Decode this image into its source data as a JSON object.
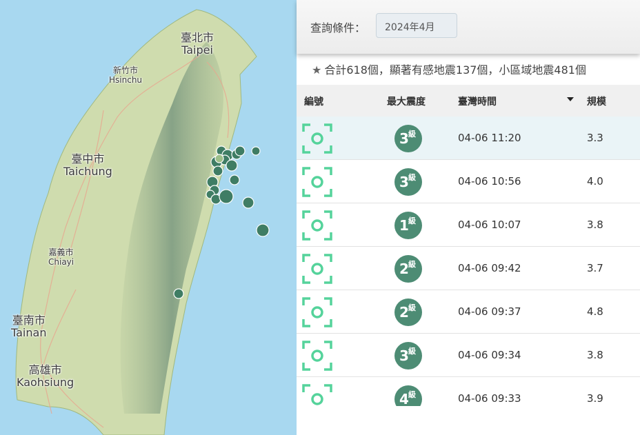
{
  "map": {
    "colors": {
      "sea": "#a8d8f0",
      "land": "#cfdcae",
      "mountain": "#8aa78a",
      "marker": "#3f7d64"
    },
    "cities": [
      {
        "zh": "臺北市",
        "en": "Taipei",
        "size": "big"
      },
      {
        "zh": "新竹市",
        "en": "Hsinchu",
        "size": "small"
      },
      {
        "zh": "臺中市",
        "en": "Taichung",
        "size": "big"
      },
      {
        "zh": "嘉義市",
        "en": "Chiayi",
        "size": "small"
      },
      {
        "zh": "臺南市",
        "en": "Tainan",
        "size": "big"
      },
      {
        "zh": "高雄市",
        "en": "Kaohsiung",
        "size": "big"
      }
    ]
  },
  "query": {
    "label": "查詢條件：",
    "selected": "2024年4月"
  },
  "summary": {
    "text": "合計618個，顯著有感地震137個，小區域地震481個"
  },
  "table": {
    "headers": {
      "id": "編號",
      "intensity": "最大震度",
      "time": "臺灣時間",
      "magnitude": "規模"
    },
    "unit": "級",
    "rows": [
      {
        "level": "3",
        "time": "04-06 11:20",
        "mag": "3.3"
      },
      {
        "level": "3",
        "time": "04-06 10:56",
        "mag": "4.0"
      },
      {
        "level": "1",
        "time": "04-06 10:07",
        "mag": "3.8"
      },
      {
        "level": "2",
        "time": "04-06 09:42",
        "mag": "3.7"
      },
      {
        "level": "2",
        "time": "04-06 09:37",
        "mag": "4.8"
      },
      {
        "level": "3",
        "time": "04-06 09:34",
        "mag": "3.8"
      },
      {
        "level": "4",
        "time": "04-06 09:33",
        "mag": "3.9"
      }
    ]
  }
}
